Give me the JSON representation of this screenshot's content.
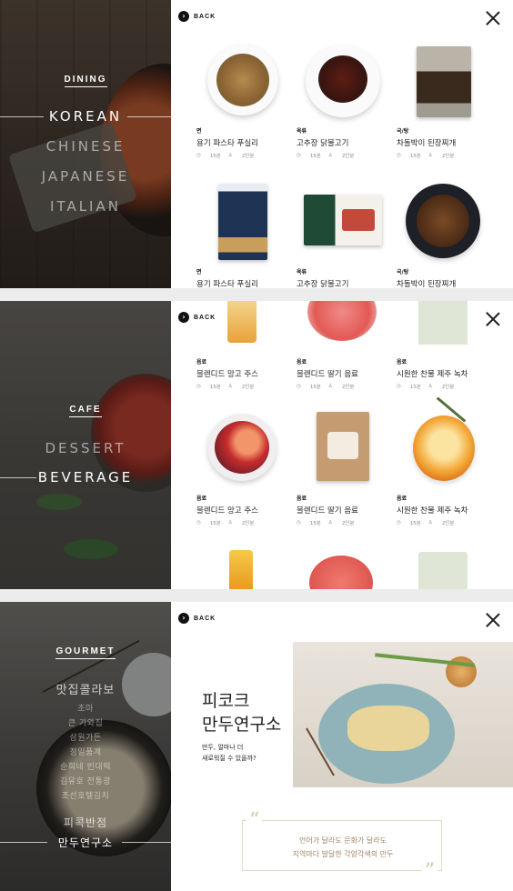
{
  "common": {
    "back_label": "BACK"
  },
  "dining": {
    "section_title": "DINING",
    "menu": [
      "KOREAN",
      "CHINESE",
      "JAPANESE",
      "ITALIAN"
    ],
    "active_index": 0,
    "cards": [
      {
        "category": "면",
        "name": "용기 파스타 푸실리",
        "time": "15분",
        "servings": "2인분"
      },
      {
        "category": "육류",
        "name": "고추장 닭불고기",
        "time": "15분",
        "servings": "2인분"
      },
      {
        "category": "국/탕",
        "name": "차돌박이 된장찌개",
        "time": "15분",
        "servings": "2인분"
      },
      {
        "category": "면",
        "name": "용기 파스타 푸실리",
        "time": "",
        "servings": ""
      },
      {
        "category": "육류",
        "name": "고추장 닭불고기",
        "time": "",
        "servings": ""
      },
      {
        "category": "국/탕",
        "name": "차돌박이 된장찌개",
        "time": "",
        "servings": ""
      }
    ]
  },
  "cafe": {
    "section_title": "CAFE",
    "menu": [
      "DESSERT",
      "BEVERAGE"
    ],
    "active_index": 1,
    "cards": [
      {
        "category": "음료",
        "name": "블렌디드 망고 주스",
        "time": "15분",
        "servings": "2인분"
      },
      {
        "category": "음료",
        "name": "블렌디드 딸기 음료",
        "time": "15분",
        "servings": "2인분"
      },
      {
        "category": "음료",
        "name": "시원한 찬물 제주 녹차",
        "time": "15분",
        "servings": "2인분"
      },
      {
        "category": "음료",
        "name": "블렌디드 망고 주스",
        "time": "15분",
        "servings": "2인분"
      },
      {
        "category": "음료",
        "name": "블렌디드 딸기 음료",
        "time": "15분",
        "servings": "2인분"
      },
      {
        "category": "음료",
        "name": "시원한 찬물 제주 녹차",
        "time": "15분",
        "servings": "2인분"
      }
    ]
  },
  "gourmet": {
    "section_title": "GOURMET",
    "menu_top": "맛집콜라보",
    "menu_small": [
      "초마",
      "큰 기와집",
      "삼원가든",
      "정일품계",
      "순희네 빈대떡",
      "김유호 전통광",
      "조선호텔김치"
    ],
    "menu_bottom": [
      "피콕반점",
      "만두연구소"
    ],
    "active_label": "만두연구소",
    "detail": {
      "title_line1": "피코크",
      "title_line2": "만두연구소",
      "subtitle_line1": "만두, 얼마나 더",
      "subtitle_line2": "새로워질 수 있을까?",
      "quote_line1": "언어가 달라도 문화가 달라도",
      "quote_line2": "지역마다 발달한 각양각색의 만두"
    }
  },
  "colors": {
    "divider_gray": "#ececec",
    "quote_gold": "#a08566",
    "text_dark": "#222222"
  }
}
